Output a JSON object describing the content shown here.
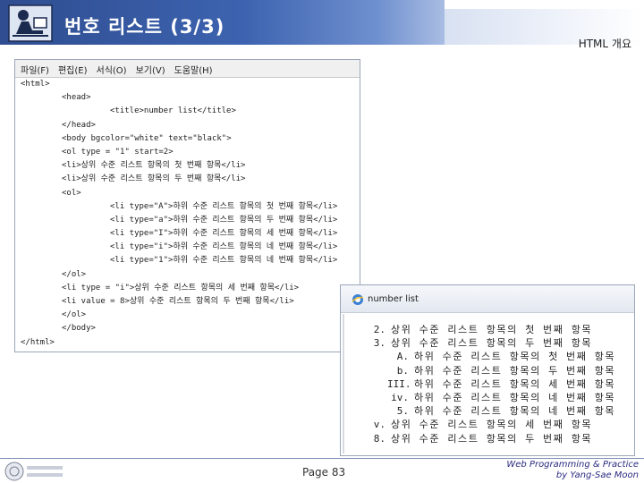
{
  "slide": {
    "title": "번호 리스트 (3/3)",
    "section": "HTML 개요",
    "page": "Page 83",
    "credit_line1": "Web Programming & Practice",
    "credit_line2": "by Yang-Sae Moon"
  },
  "notepad": {
    "menu": [
      "파일(F)",
      "편집(E)",
      "서식(O)",
      "보기(V)",
      "도움말(H)"
    ],
    "lines": [
      {
        "indent": 0,
        "text": "<html>"
      },
      {
        "indent": 1,
        "text": "<head>"
      },
      {
        "indent": 2,
        "text": "<title>number list</title>"
      },
      {
        "indent": 1,
        "text": "</head>"
      },
      {
        "indent": 1,
        "text": "<body bgcolor=\"white\" text=\"black\">"
      },
      {
        "indent": 1,
        "text": "<ol type = \"1\" start=2>"
      },
      {
        "indent": 1,
        "text": "<li>상위 수준 리스트 항목의 첫 번째 항목</li>"
      },
      {
        "indent": 1,
        "text": "<li>상위 수준 리스트 항목의 두 번째 항목</li>"
      },
      {
        "indent": 1,
        "text": "<ol>"
      },
      {
        "indent": 2,
        "text": "<li type=\"A\">하위 수준 리스트 항목의 첫 번째 항목</li>"
      },
      {
        "indent": 2,
        "text": "<li type=\"a\">하위 수준 리스트 항목의 두 번째 항목</li>"
      },
      {
        "indent": 2,
        "text": "<li type=\"I\">하위 수준 리스트 항목의 세 번째 항목</li>"
      },
      {
        "indent": 2,
        "text": "<li type=\"i\">하위 수준 리스트 항목의 네 번째 항목</li>"
      },
      {
        "indent": 2,
        "text": "<li type=\"1\">하위 수준 리스트 항목의 네 번째 항목</li>"
      },
      {
        "indent": 1,
        "text": "</ol>"
      },
      {
        "indent": 1,
        "text": "<li type = \"i\">상위 수준 리스트 항목의 세 번째 항목</li>"
      },
      {
        "indent": 1,
        "text": "<li value = 8>상위 수준 리스트 항목의 두 번째 항목</li>"
      },
      {
        "indent": 1,
        "text": "</ol>"
      },
      {
        "indent": 1,
        "text": "</body>"
      },
      {
        "indent": 0,
        "text": "</html>"
      }
    ]
  },
  "browser": {
    "tab_title": "number list",
    "items": [
      {
        "level": 0,
        "marker": "2.",
        "text": "상위 수준 리스트 항목의 첫 번째 항목"
      },
      {
        "level": 0,
        "marker": "3.",
        "text": "상위 수준 리스트 항목의 두 번째 항목"
      },
      {
        "level": 1,
        "marker": "A.",
        "text": "하위 수준 리스트 항목의 첫 번째 항목"
      },
      {
        "level": 1,
        "marker": "b.",
        "text": "하위 수준 리스트 항목의 두 번째 항목"
      },
      {
        "level": 1,
        "marker": "III.",
        "text": "하위 수준 리스트 항목의 세 번째 항목"
      },
      {
        "level": 1,
        "marker": "iv.",
        "text": "하위 수준 리스트 항목의 네 번째 항목"
      },
      {
        "level": 1,
        "marker": "5.",
        "text": "하위 수준 리스트 항목의 네 번째 항목"
      },
      {
        "level": 0,
        "marker": "v.",
        "text": "상위 수준 리스트 항목의 세 번째 항목"
      },
      {
        "level": 0,
        "marker": "8.",
        "text": "상위 수준 리스트 항목의 두 번째 항목"
      }
    ]
  },
  "icons": {
    "title": "person-at-computer-icon",
    "browser": "internet-explorer-icon",
    "footer": "university-logo"
  }
}
